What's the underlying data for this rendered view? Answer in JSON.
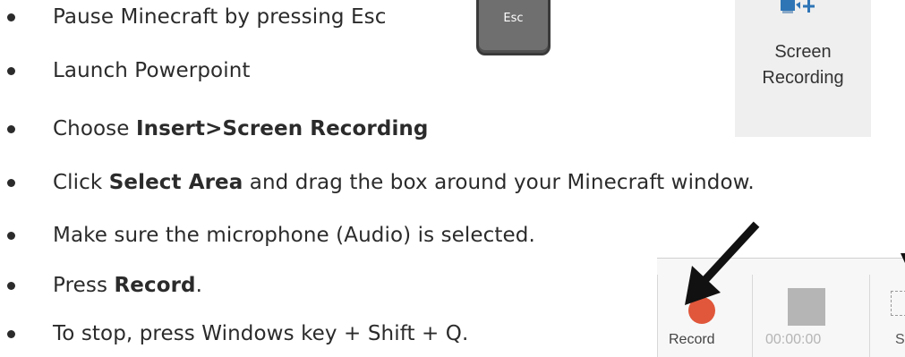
{
  "bullets": [
    {
      "pre": "Pause Minecraft by pressing Esc",
      "bold": "",
      "post": ""
    },
    {
      "pre": "Launch Powerpoint",
      "bold": "",
      "post": ""
    },
    {
      "pre": "Choose ",
      "bold": "Insert>Screen Recording",
      "post": ""
    },
    {
      "pre": "Click ",
      "bold": "Select Area",
      "post": " and drag the box around your Minecraft window."
    },
    {
      "pre": "Make sure the microphone (Audio) is selected.",
      "bold": "",
      "post": ""
    },
    {
      "pre": "Press ",
      "bold": "Record",
      "post": "."
    },
    {
      "pre": "To stop, press Windows key + Shift + Q.",
      "bold": "",
      "post": ""
    }
  ],
  "esc_key": {
    "label": "Esc"
  },
  "screen_recording": {
    "line1": "Screen",
    "line2": "Recording"
  },
  "recording_bar": {
    "record_label": "Record",
    "timer": "00:00:00",
    "select_area_label": "S"
  },
  "colors": {
    "record_dot": "#e0573b",
    "stop_square": "#b5b5b5",
    "ribbon_button_bg": "#efefef",
    "text": "#2b2b2b"
  },
  "icons": [
    "screen-recording-icon",
    "record-icon",
    "stop-icon",
    "select-area-icon",
    "pointer-arrow-icon"
  ]
}
